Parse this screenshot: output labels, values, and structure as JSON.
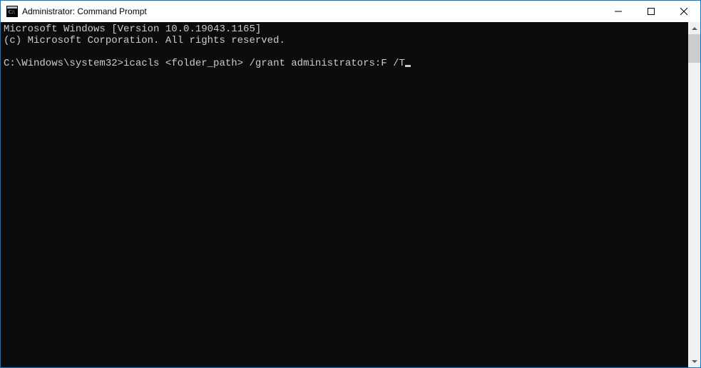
{
  "titlebar": {
    "title": "Administrator: Command Prompt"
  },
  "terminal": {
    "line1": "Microsoft Windows [Version 10.0.19043.1165]",
    "line2": "(c) Microsoft Corporation. All rights reserved.",
    "blank": "",
    "prompt": "C:\\Windows\\system32>",
    "command": "icacls <folder_path> /grant administrators:F /T"
  }
}
